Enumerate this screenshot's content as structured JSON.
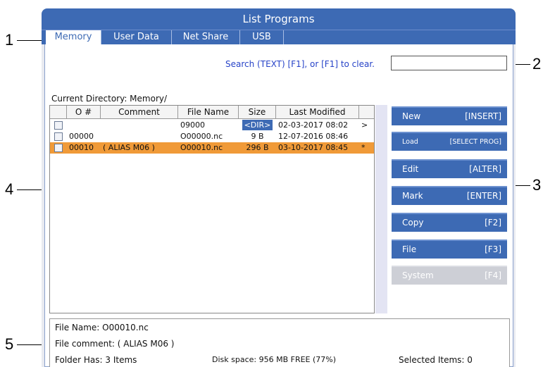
{
  "callouts": [
    "1",
    "2",
    "3",
    "4",
    "5"
  ],
  "window": {
    "title": "List Programs"
  },
  "tabs": [
    {
      "label": "Memory",
      "active": true
    },
    {
      "label": "User Data",
      "active": false
    },
    {
      "label": "Net Share",
      "active": false
    },
    {
      "label": "USB",
      "active": false
    }
  ],
  "search": {
    "hint": "Search (TEXT) [F1], or [F1] to clear.",
    "value": ""
  },
  "current_directory": "Current Directory: Memory/",
  "columns": [
    "O #",
    "Comment",
    "File Name",
    "Size",
    "Last Modified"
  ],
  "rows": [
    {
      "onum": "",
      "comment": "",
      "filename": "09000",
      "size": "<DIR>",
      "modified": "02-03-2017 08:02",
      "flag": ">",
      "selected": false
    },
    {
      "onum": "00000",
      "comment": "",
      "filename": "O00000.nc",
      "size": "9 B",
      "modified": "12-07-2016 08:46",
      "flag": "",
      "selected": false
    },
    {
      "onum": "00010",
      "comment": "( ALIAS M06 )",
      "filename": "O00010.nc",
      "size": "296 B",
      "modified": "03-10-2017 08:45",
      "flag": "*",
      "selected": true
    }
  ],
  "buttons": [
    {
      "label": "New",
      "key": "[INSERT]",
      "enabled": true
    },
    {
      "label": "Load",
      "key": "[SELECT PROG]",
      "enabled": true
    },
    {
      "label": "Edit",
      "key": "[ALTER]",
      "enabled": true
    },
    {
      "label": "Mark",
      "key": "[ENTER]",
      "enabled": true
    },
    {
      "label": "Copy",
      "key": "[F2]",
      "enabled": true
    },
    {
      "label": "File",
      "key": "[F3]",
      "enabled": true
    },
    {
      "label": "System",
      "key": "[F4]",
      "enabled": false
    }
  ],
  "info": {
    "file_name": "File Name: O00010.nc",
    "file_comment": "File comment: ( ALIAS M06 )",
    "folder_has": "Folder Has: 3 Items",
    "disk_space": "Disk space: 956 MB FREE (77%)",
    "selected_items": "Selected Items: 0"
  },
  "colors": {
    "accent": "#3d6ab4",
    "selected_row": "#f09a38",
    "hint_text": "#2743c8",
    "disabled_button": "#cdcfd6"
  }
}
